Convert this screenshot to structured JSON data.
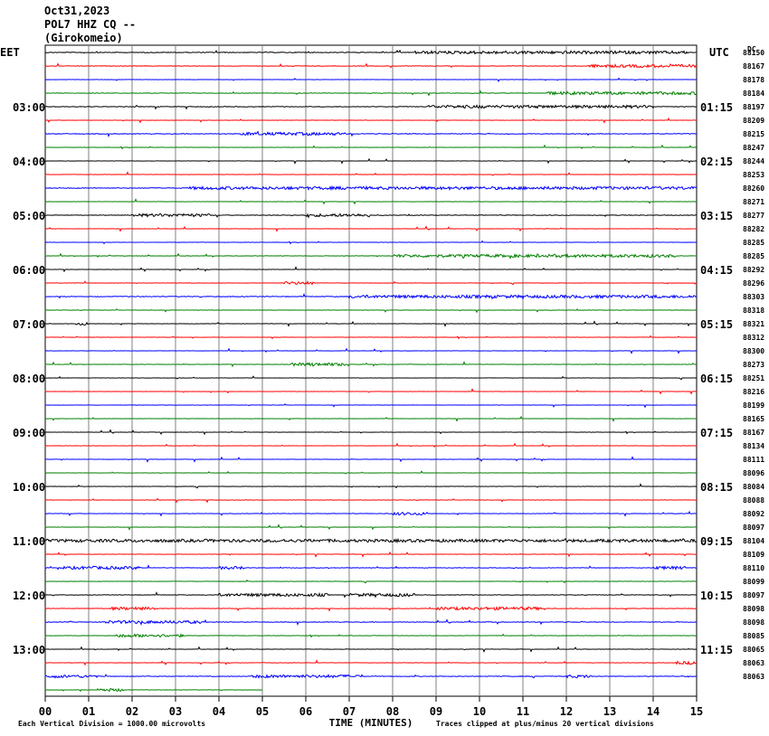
{
  "header": {
    "date": "Oct31,2023",
    "station": "POL7 HHZ CQ --",
    "location": "(Girokomeio)"
  },
  "chart_data": {
    "type": "seismogram-helicorder",
    "left_zone": "EET",
    "right_zone": "UTC",
    "dc_label": "DC",
    "xlabel": "TIME (MINUTES)",
    "footer_left": "Each Vertical Division = 1000.00 microvolts",
    "footer_right": "Traces clipped at plus/minus 20 vertical divisions",
    "x_ticks": [
      "00",
      "01",
      "02",
      "03",
      "04",
      "05",
      "06",
      "07",
      "08",
      "09",
      "10",
      "11",
      "12",
      "13",
      "14",
      "15"
    ],
    "xlim": [
      0,
      15
    ],
    "trace_colors": [
      "#000000",
      "#ff0000",
      "#0000ff",
      "#008000"
    ],
    "left_hour_labels": [
      {
        "row": 4,
        "label": "03:00"
      },
      {
        "row": 8,
        "label": "04:00"
      },
      {
        "row": 12,
        "label": "05:00"
      },
      {
        "row": 16,
        "label": "06:00"
      },
      {
        "row": 20,
        "label": "07:00"
      },
      {
        "row": 24,
        "label": "08:00"
      },
      {
        "row": 28,
        "label": "09:00"
      },
      {
        "row": 32,
        "label": "10:00"
      },
      {
        "row": 36,
        "label": "11:00"
      },
      {
        "row": 40,
        "label": "12:00"
      },
      {
        "row": 44,
        "label": "13:00"
      }
    ],
    "right_hour_labels": [
      {
        "row": 4,
        "label": "01:15"
      },
      {
        "row": 8,
        "label": "02:15"
      },
      {
        "row": 12,
        "label": "03:15"
      },
      {
        "row": 16,
        "label": "04:15"
      },
      {
        "row": 20,
        "label": "05:15"
      },
      {
        "row": 24,
        "label": "06:15"
      },
      {
        "row": 28,
        "label": "07:15"
      },
      {
        "row": 32,
        "label": "08:15"
      },
      {
        "row": 36,
        "label": "09:15"
      },
      {
        "row": 40,
        "label": "10:15"
      },
      {
        "row": 44,
        "label": "11:15"
      }
    ],
    "dc_offsets": [
      "88150",
      "88167",
      "88178",
      "88184",
      "88197",
      "88209",
      "88215",
      "88247",
      "88244",
      "88253",
      "88260",
      "88271",
      "88277",
      "88282",
      "88285",
      "88285",
      "88292",
      "88296",
      "88303",
      "88318",
      "88321",
      "88312",
      "88300",
      "88273",
      "88251",
      "88216",
      "88199",
      "88165",
      "88167",
      "88134",
      "88111",
      "88096",
      "88084",
      "88088",
      "88092",
      "88097",
      "88104",
      "88109",
      "88110",
      "88099",
      "88097",
      "88098",
      "88098",
      "88085",
      "88065",
      "88063",
      "88063"
    ],
    "last_trace_end_minute": 5,
    "traces": [
      {
        "row": 0,
        "color": "black",
        "busy": [
          [
            8.5,
            14.8
          ]
        ],
        "noise": 0.4
      },
      {
        "row": 1,
        "color": "red",
        "busy": [
          [
            12.5,
            15
          ]
        ],
        "noise": 0.3
      },
      {
        "row": 2,
        "color": "blue",
        "busy": [],
        "noise": 0.15
      },
      {
        "row": 3,
        "color": "green",
        "busy": [
          [
            11.5,
            15
          ]
        ],
        "noise": 0.3
      },
      {
        "row": 4,
        "color": "black",
        "busy": [
          [
            8.8,
            14
          ]
        ],
        "noise": 0.35
      },
      {
        "row": 5,
        "color": "red",
        "busy": [],
        "noise": 0.15
      },
      {
        "row": 6,
        "color": "blue",
        "busy": [
          [
            4.5,
            6.9
          ]
        ],
        "noise": 0.4
      },
      {
        "row": 7,
        "color": "green",
        "busy": [],
        "noise": 0.15
      },
      {
        "row": 8,
        "color": "black",
        "busy": [],
        "noise": 0.15
      },
      {
        "row": 9,
        "color": "red",
        "busy": [],
        "noise": 0.15
      },
      {
        "row": 10,
        "color": "blue",
        "busy": [
          [
            3.3,
            15
          ]
        ],
        "noise": 0.45
      },
      {
        "row": 11,
        "color": "green",
        "busy": [],
        "noise": 0.15
      },
      {
        "row": 12,
        "color": "black",
        "busy": [
          [
            2.0,
            3.8
          ],
          [
            6.0,
            7.5
          ]
        ],
        "noise": 0.35
      },
      {
        "row": 13,
        "color": "red",
        "busy": [],
        "noise": 0.15
      },
      {
        "row": 14,
        "color": "blue",
        "busy": [],
        "noise": 0.15
      },
      {
        "row": 15,
        "color": "green",
        "busy": [
          [
            8.0,
            14.5
          ]
        ],
        "noise": 0.25
      },
      {
        "row": 16,
        "color": "black",
        "busy": [],
        "noise": 0.15
      },
      {
        "row": 17,
        "color": "red",
        "busy": [
          [
            5.5,
            6.2
          ]
        ],
        "noise": 0.2
      },
      {
        "row": 18,
        "color": "blue",
        "busy": [
          [
            7.0,
            15
          ]
        ],
        "noise": 0.4
      },
      {
        "row": 19,
        "color": "green",
        "busy": [],
        "noise": 0.2
      },
      {
        "row": 20,
        "color": "black",
        "busy": [
          [
            0.7,
            1.0
          ]
        ],
        "noise": 0.2
      },
      {
        "row": 21,
        "color": "red",
        "busy": [],
        "noise": 0.15
      },
      {
        "row": 22,
        "color": "blue",
        "busy": [],
        "noise": 0.15
      },
      {
        "row": 23,
        "color": "green",
        "busy": [
          [
            5.6,
            6.9
          ]
        ],
        "noise": 0.2
      },
      {
        "row": 24,
        "color": "black",
        "busy": [],
        "noise": 0.15
      },
      {
        "row": 25,
        "color": "red",
        "busy": [],
        "noise": 0.15
      },
      {
        "row": 26,
        "color": "blue",
        "busy": [],
        "noise": 0.15
      },
      {
        "row": 27,
        "color": "green",
        "busy": [],
        "noise": 0.15
      },
      {
        "row": 28,
        "color": "black",
        "busy": [],
        "noise": 0.15
      },
      {
        "row": 29,
        "color": "red",
        "busy": [],
        "noise": 0.15
      },
      {
        "row": 30,
        "color": "blue",
        "busy": [],
        "noise": 0.15
      },
      {
        "row": 31,
        "color": "green",
        "busy": [],
        "noise": 0.15
      },
      {
        "row": 32,
        "color": "black",
        "busy": [],
        "noise": 0.2
      },
      {
        "row": 33,
        "color": "red",
        "busy": [],
        "noise": 0.2
      },
      {
        "row": 34,
        "color": "blue",
        "busy": [
          [
            8.0,
            8.8
          ]
        ],
        "noise": 0.25
      },
      {
        "row": 35,
        "color": "green",
        "busy": [],
        "noise": 0.2
      },
      {
        "row": 36,
        "color": "black",
        "busy": [
          [
            0,
            15
          ]
        ],
        "noise": 0.35
      },
      {
        "row": 37,
        "color": "red",
        "busy": [],
        "noise": 0.2
      },
      {
        "row": 38,
        "color": "blue",
        "busy": [
          [
            0.4,
            2.2
          ],
          [
            4.0,
            4.6
          ],
          [
            14.0,
            14.8
          ]
        ],
        "noise": 0.3
      },
      {
        "row": 39,
        "color": "green",
        "busy": [],
        "noise": 0.2
      },
      {
        "row": 40,
        "color": "black",
        "busy": [
          [
            4.0,
            6.5
          ],
          [
            7.0,
            8.5
          ]
        ],
        "noise": 0.3
      },
      {
        "row": 41,
        "color": "red",
        "busy": [
          [
            1.5,
            2.6
          ],
          [
            9.0,
            11.5
          ]
        ],
        "noise": 0.3
      },
      {
        "row": 42,
        "color": "blue",
        "busy": [
          [
            1.3,
            3.6
          ]
        ],
        "noise": 0.35
      },
      {
        "row": 43,
        "color": "green",
        "busy": [
          [
            1.6,
            3.2
          ]
        ],
        "noise": 0.2
      },
      {
        "row": 44,
        "color": "black",
        "busy": [],
        "noise": 0.2
      },
      {
        "row": 45,
        "color": "red",
        "busy": [
          [
            14.5,
            15
          ]
        ],
        "noise": 0.2
      },
      {
        "row": 46,
        "color": "blue",
        "busy": [
          [
            0,
            1.2
          ],
          [
            4.7,
            7.3
          ],
          [
            12.0,
            12.6
          ]
        ],
        "noise": 0.35
      },
      {
        "row": 47,
        "color": "green",
        "busy": [
          [
            1.2,
            1.8
          ]
        ],
        "noise": 0.2
      }
    ]
  }
}
